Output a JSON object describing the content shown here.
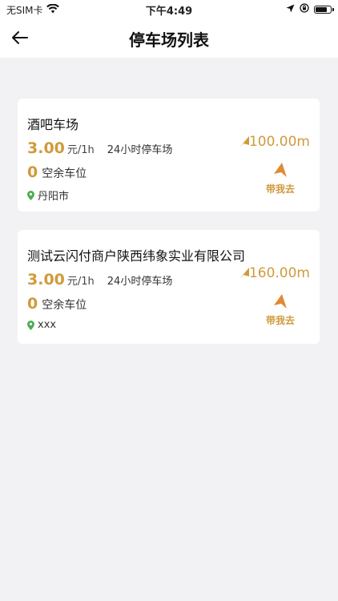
{
  "status_bar": {
    "carrier": "无SIM卡",
    "time": "下午4:49"
  },
  "header": {
    "title": "停车场列表"
  },
  "colors": {
    "accent": "#d09a3c",
    "location_pin": "#4caf50",
    "background": "#f2f2f5"
  },
  "parking_lots": [
    {
      "name": "酒吧车场",
      "price": "3.00",
      "unit": "元/1h",
      "hours": "24小时停车场",
      "spaces": "0",
      "spaces_label": "空余车位",
      "location": "丹阳市",
      "distance": "100.00m",
      "nav_label": "带我去"
    },
    {
      "name": "测试云闪付商户陕西纬象实业有限公司",
      "price": "3.00",
      "unit": "元/1h",
      "hours": "24小时停车场",
      "spaces": "0",
      "spaces_label": "空余车位",
      "location": "xxx",
      "distance": "160.00m",
      "nav_label": "带我去"
    }
  ]
}
